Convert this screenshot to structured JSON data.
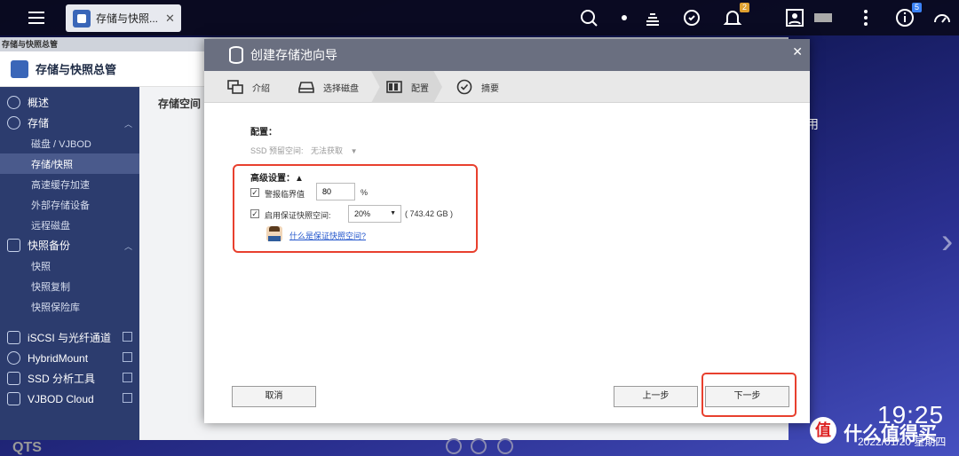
{
  "taskbar": {
    "app_tab_label": "存储与快照...",
    "notifications_count": "2",
    "info_count": "5"
  },
  "app": {
    "window_title": "存储与快照总管",
    "header_title": "存储与快照总管",
    "main_label": "存储空间",
    "sidebar": {
      "overview": "概述",
      "storage": "存储",
      "storage_items": [
        "磁盘 / VJBOD",
        "存储/快照",
        "高速缓存加速",
        "外部存储设备",
        "远程磁盘"
      ],
      "snapshot_backup": "快照备份",
      "snapshot_items": [
        "快照",
        "快照复制",
        "快照保险库"
      ],
      "iscsi": "iSCSI 与光纤通道",
      "hybridmount": "HybridMount",
      "ssd_tool": "SSD 分析工具",
      "vjbod_cloud": "VJBOD Cloud"
    }
  },
  "dialog": {
    "title": "创建存储池向导",
    "steps": [
      "介绍",
      "选择磁盘",
      "配置",
      "摘要"
    ],
    "active_step": "配置",
    "config_label": "配置：",
    "ssd_reserve_label": "SSD 预留空间:",
    "ssd_reserve_value": "无法获取",
    "advanced_title": "高级设置：▲",
    "alert_threshold_label": "警报临界值",
    "alert_threshold_value": "80",
    "percent_sign": "%",
    "guaranteed_snapshot_label": "启用保证快照空间:",
    "guaranteed_snapshot_value": "20%",
    "guaranteed_snapshot_size": "( 743.42 GB )",
    "help_link": "什么是保证快照空间?",
    "cancel_button": "取消",
    "back_button": "上一步",
    "next_button": "下一步"
  },
  "desktop": {
    "right_label": "用",
    "clock": "19:25",
    "date": "2022/01/20 星期四",
    "watermark_text": "什么值得买",
    "os_label": "QTS"
  },
  "colors": {
    "highlight": "#e8402e",
    "sidebar_bg": "#2c3c6e",
    "dialog_title_bg": "#6a6f80"
  }
}
